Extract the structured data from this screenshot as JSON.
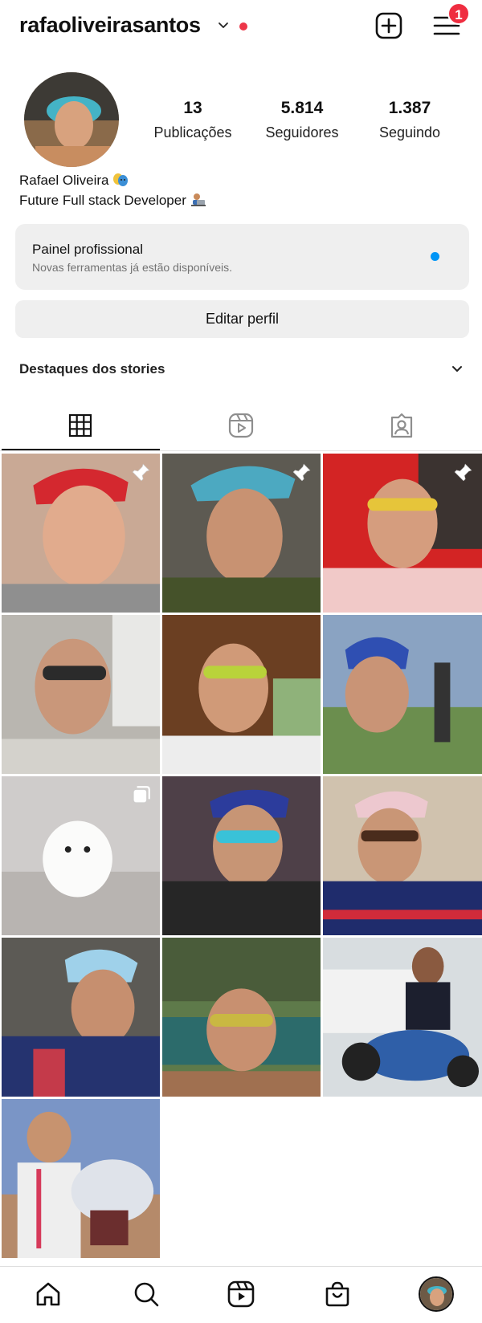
{
  "header": {
    "username": "rafaoliveirasantos",
    "notification_count": "1",
    "icons": [
      "chevron-down-icon",
      "plus-square-icon",
      "hamburger-menu-icon"
    ]
  },
  "profile": {
    "stats": [
      {
        "value": "13",
        "label": "Publicações"
      },
      {
        "value": "5.814",
        "label": "Seguidores"
      },
      {
        "value": "1.387",
        "label": "Seguindo"
      }
    ],
    "name": "Rafael Oliveira",
    "bio": "Future Full stack Developer"
  },
  "professional_panel": {
    "title": "Painel profissional",
    "subtitle": "Novas ferramentas já estão disponíveis."
  },
  "edit_profile_label": "Editar perfil",
  "highlights_label": "Destaques dos stories",
  "tabs": [
    "grid-icon",
    "reels-icon",
    "tagged-icon"
  ],
  "grid": {
    "posts": [
      {
        "type": "pinned-post",
        "overlay_icon": "pin-icon"
      },
      {
        "type": "pinned-post",
        "overlay_icon": "pin-icon"
      },
      {
        "type": "pinned-post",
        "overlay_icon": "pin-icon"
      },
      {
        "type": "post"
      },
      {
        "type": "post"
      },
      {
        "type": "post"
      },
      {
        "type": "carousel-post",
        "overlay_icon": "carousel-icon"
      },
      {
        "type": "post"
      },
      {
        "type": "post"
      },
      {
        "type": "post"
      },
      {
        "type": "post"
      },
      {
        "type": "post"
      },
      {
        "type": "post"
      }
    ]
  },
  "bottom_nav": [
    "home-icon",
    "search-icon",
    "reels-icon",
    "shop-icon",
    "profile-avatar"
  ],
  "colors": {
    "badge": "#ef2d40",
    "live_dot": "#ed3649",
    "panel_dot": "#0095f6",
    "button_bg": "#efefef"
  }
}
